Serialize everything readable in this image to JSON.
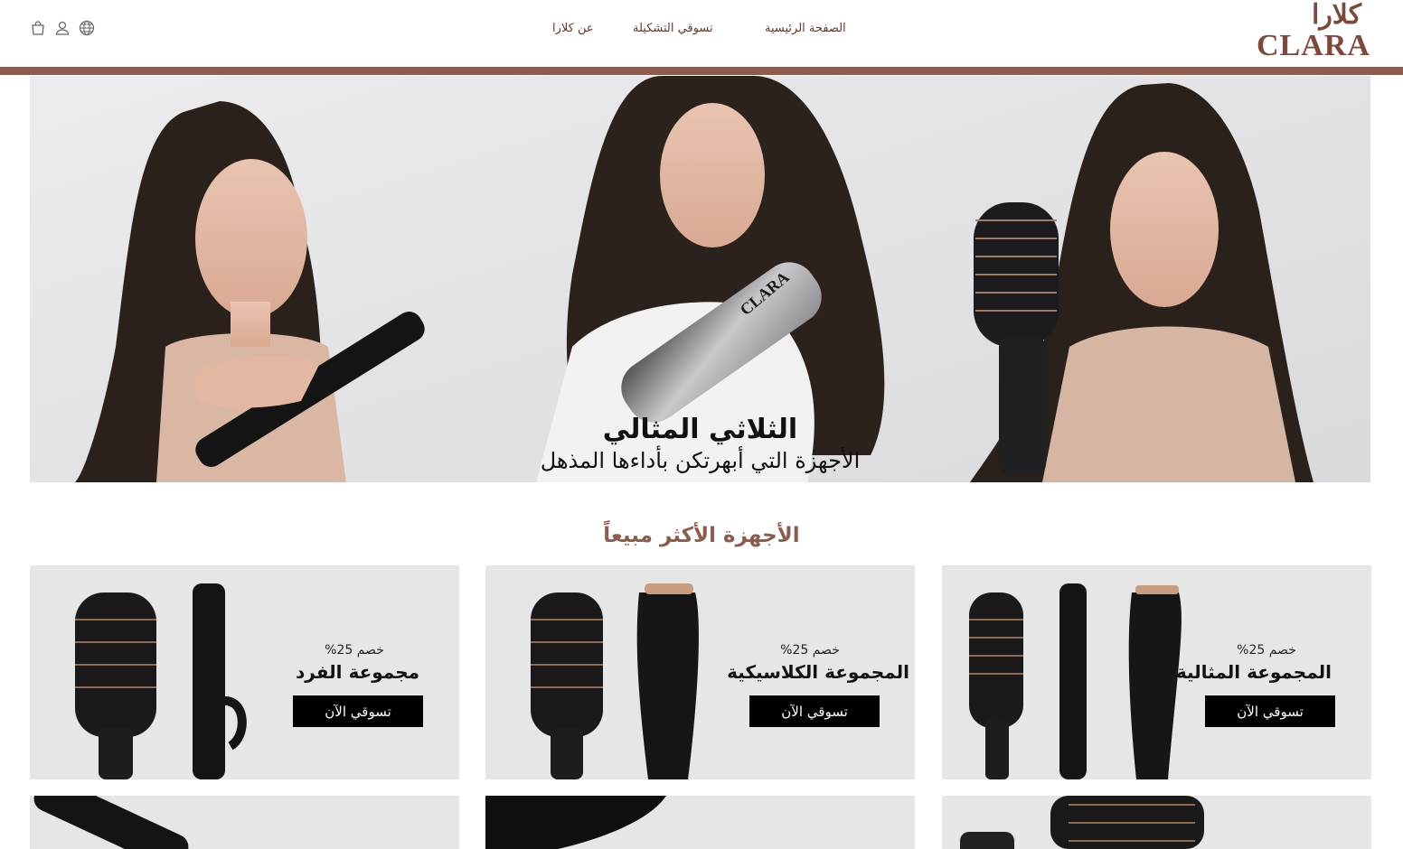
{
  "header": {
    "nav": {
      "home": "الصفحة الرئيسية",
      "shop": "تسوقي التشكيلة",
      "about": "عن كلارا"
    },
    "logo": {
      "arabic": "كلارا",
      "english": "CLARA"
    },
    "icons": [
      "cart-icon",
      "user-icon",
      "globe-icon"
    ],
    "accent_color": "#8a5d4e"
  },
  "hero": {
    "title": "الثلاثي المثالي",
    "subtitle": "الأجهزة التي أبهرتكن بأداءها المذهل",
    "product_brand": "CLARA"
  },
  "bestsellers": {
    "title": "الأجهزة الأكثر مبيعاً",
    "cards": [
      {
        "discount": "خصم 25%",
        "name": "المجموعة المثالية",
        "button": "تسوقي الآن"
      },
      {
        "discount": "خصم 25%",
        "name": "المجموعة الكلاسيكية",
        "button": "تسوقي الآن"
      },
      {
        "discount": "خصم 25%",
        "name": "مجموعة الفرد",
        "button": "تسوقي الآن"
      }
    ]
  }
}
